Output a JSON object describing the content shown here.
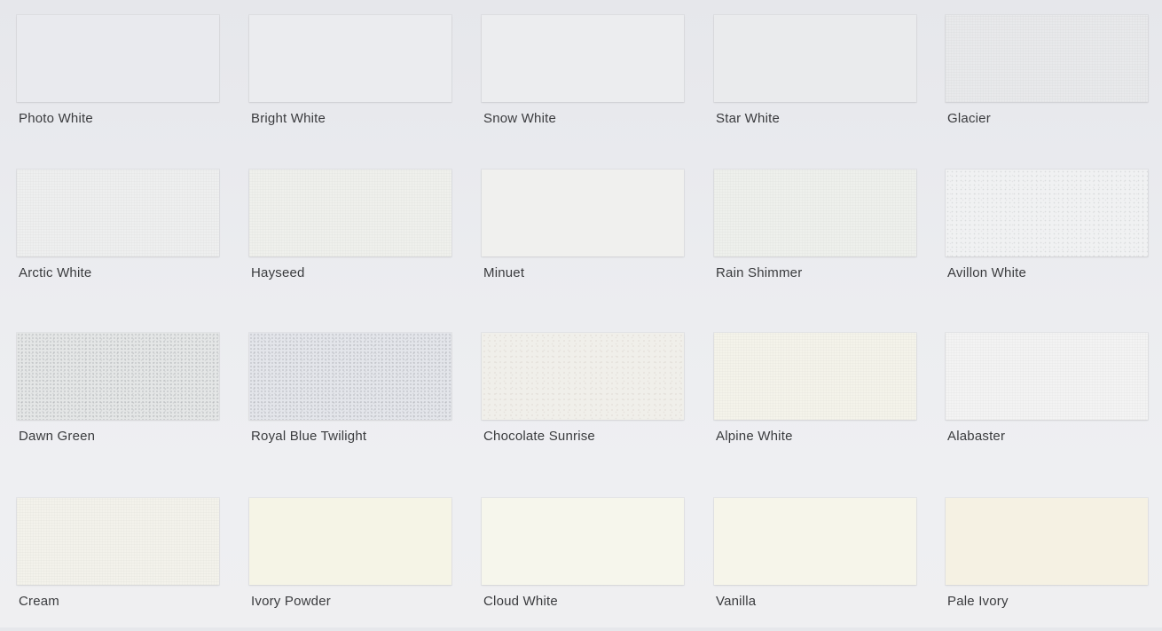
{
  "swatches": [
    {
      "name": "Photo White",
      "color": "#e9eaee",
      "texture": "plain"
    },
    {
      "name": "Bright White",
      "color": "#ebecef",
      "texture": "plain"
    },
    {
      "name": "Snow White",
      "color": "#ecedef",
      "texture": "plain"
    },
    {
      "name": "Star White",
      "color": "#eaebed",
      "texture": "plain"
    },
    {
      "name": "Glacier",
      "color": "#e8e9eb",
      "texture": "linen"
    },
    {
      "name": "Arctic White",
      "color": "#eeefef",
      "texture": "linen"
    },
    {
      "name": "Hayseed",
      "color": "#eff0ec",
      "texture": "linen"
    },
    {
      "name": "Minuet",
      "color": "#f0f0ee",
      "texture": "plain"
    },
    {
      "name": "Rain Shimmer",
      "color": "#eef0ec",
      "texture": "linen"
    },
    {
      "name": "Avillon White",
      "color": "#f0f1f2",
      "texture": "speckle"
    },
    {
      "name": "Dawn Green",
      "color": "#e4e6e6",
      "texture": "heavy-speckle"
    },
    {
      "name": "Royal Blue Twilight",
      "color": "#e3e5ea",
      "texture": "heavy-speckle"
    },
    {
      "name": "Chocolate Sunrise",
      "color": "#f0efea",
      "texture": "fiber"
    },
    {
      "name": "Alpine White",
      "color": "#f4f3ea",
      "texture": "linen"
    },
    {
      "name": "Alabaster",
      "color": "#f3f3f3",
      "texture": "linen"
    },
    {
      "name": "Cream",
      "color": "#f3f2eb",
      "texture": "linen"
    },
    {
      "name": "Ivory Powder",
      "color": "#f5f4e6",
      "texture": "plain"
    },
    {
      "name": "Cloud White",
      "color": "#f6f6ec",
      "texture": "plain"
    },
    {
      "name": "Vanilla",
      "color": "#f6f5ea",
      "texture": "plain"
    },
    {
      "name": "Pale Ivory",
      "color": "#f5f1e3",
      "texture": "plain"
    }
  ]
}
